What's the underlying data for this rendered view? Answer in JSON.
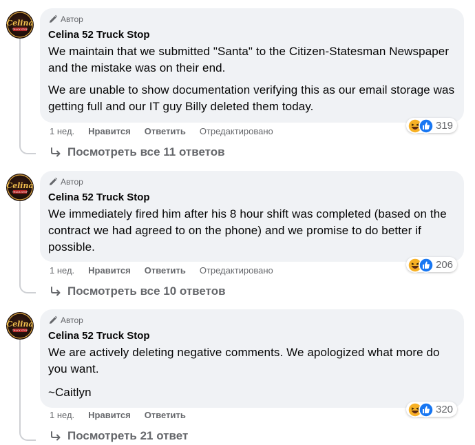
{
  "comments": [
    {
      "badge": "Автор",
      "author": "Celina 52 Truck Stop",
      "paragraphs": [
        "We maintain that we submitted \"Santa\" to the Citizen-Statesman Newspaper and the mistake was on their end.",
        "We are unable to show documentation verifying this as our email storage was getting full and our IT guy Billy deleted them today."
      ],
      "time": "1 нед.",
      "like": "Нравится",
      "reply": "Ответить",
      "edited": "Отредактировано",
      "reaction_count": "319",
      "replies_link": "Посмотреть все 11 ответов"
    },
    {
      "badge": "Автор",
      "author": "Celina 52 Truck Stop",
      "paragraphs": [
        "We immediately fired him after his 8 hour shift was completed (based on the contract we had agreed to on the phone) and we promise to do better if possible."
      ],
      "time": "1 нед.",
      "like": "Нравится",
      "reply": "Ответить",
      "edited": "Отредактировано",
      "reaction_count": "206",
      "replies_link": "Посмотреть все 10 ответов"
    },
    {
      "badge": "Автор",
      "author": "Celina 52 Truck Stop",
      "paragraphs": [
        "We are actively deleting negative comments. We apologized what more do you want.",
        "~Caitlyn"
      ],
      "time": "1 нед.",
      "like": "Нравится",
      "reply": "Ответить",
      "reaction_count": "320",
      "replies_link": "Посмотреть 21 ответ"
    }
  ],
  "avatar_text": "Celina",
  "avatar_subtext": "TRUCK STOP",
  "icons": {
    "badge": "pencil-icon",
    "haha": "haha-reaction-icon",
    "like": "like-reaction-icon",
    "reply_arrow": "reply-arrow-icon"
  },
  "colors": {
    "bubble": "#f0f2f5",
    "meta": "#65676b",
    "like_blue": "#1877f2",
    "haha_yellow": "#f7b125"
  }
}
